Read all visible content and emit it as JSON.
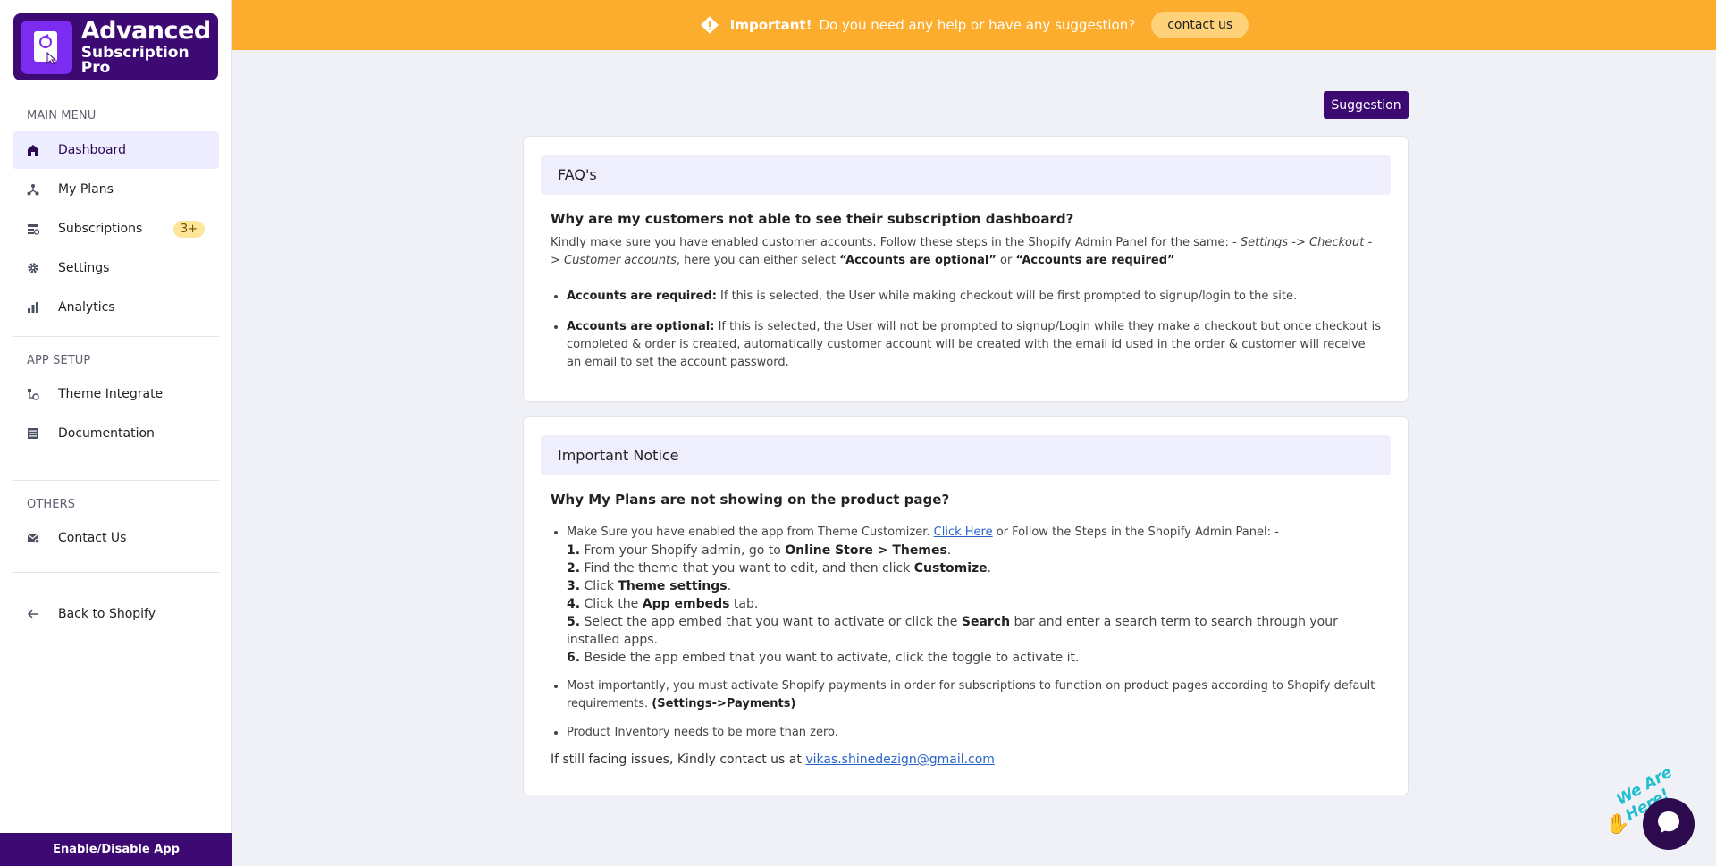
{
  "logo": {
    "line1": "Advanced",
    "line2": "Subscription Pro"
  },
  "sidebar": {
    "main_menu_title": "MAIN MENU",
    "main_items": [
      {
        "label": "Dashboard",
        "icon": "home-icon",
        "active": true
      },
      {
        "label": "My Plans",
        "icon": "plans-icon"
      },
      {
        "label": "Subscriptions",
        "icon": "subscriptions-icon",
        "badge": "3+"
      },
      {
        "label": "Settings",
        "icon": "gear-icon"
      },
      {
        "label": "Analytics",
        "icon": "bar-chart-icon"
      }
    ],
    "app_setup_title": "APP SETUP",
    "setup_items": [
      {
        "label": "Theme Integrate",
        "icon": "theme-icon"
      },
      {
        "label": "Documentation",
        "icon": "document-icon"
      }
    ],
    "others_title": "OTHERS",
    "others_items": [
      {
        "label": "Contact Us",
        "icon": "mail-icon"
      }
    ],
    "back_label": "Back to Shopify",
    "enable_label": "Enable/Disable App"
  },
  "banner": {
    "strong": "Important!",
    "text": "Do you need any help or have any suggestion?",
    "button": "contact us"
  },
  "suggestion_button": "Suggestion",
  "faq": {
    "title": "FAQ's",
    "question": "Why are my customers not able to see their subscription dashboard?",
    "intro_1": "Kindly make sure you have enabled customer accounts. Follow these steps in the Shopify Admin Panel for the same: - ",
    "intro_path": "Settings -> Checkout -> Customer accounts",
    "intro_2": ", here you can either select ",
    "opt_a": "“Accounts are optional”",
    "intro_or": " or ",
    "opt_b": "“Accounts are required”",
    "bullets": [
      {
        "strong": "Accounts are required:",
        "text": " If this is selected, the User while making checkout will be first prompted to signup/login to the site."
      },
      {
        "strong": "Accounts are optional:",
        "text": " If this is selected, the User will not be prompted to signup/Login while they make a checkout but once checkout is completed & order is created, automatically customer account will be created with the email id used in the order & customer will receive an email to set the account password."
      }
    ]
  },
  "notice": {
    "title": "Important Notice",
    "question": "Why My Plans are not showing on the product page?",
    "b1_pre": "Make Sure you have enabled the app from Theme Customizer. ",
    "b1_link": "Click Here",
    "b1_post": " or Follow the Steps in the Shopify Admin Panel: -",
    "steps": [
      {
        "n": "1.",
        "pre": " From your Shopify admin, go to ",
        "b": "Online Store > Themes",
        "post": "."
      },
      {
        "n": "2.",
        "pre": " Find the theme that you want to edit, and then click ",
        "b": "Customize",
        "post": "."
      },
      {
        "n": "3.",
        "pre": " Click ",
        "b": "Theme settings",
        "post": "."
      },
      {
        "n": "4.",
        "pre": " Click the ",
        "b": "App embeds",
        "post": " tab."
      },
      {
        "n": "5.",
        "pre": " Select the app embed that you want to activate or click the ",
        "b": "Search",
        "post": " bar and enter a search term to search through your installed apps."
      },
      {
        "n": "6.",
        "pre": " Beside the app embed that you want to activate, click the toggle to activate it.",
        "b": "",
        "post": ""
      }
    ],
    "b2_text": "Most importantly, you must activate Shopify payments in order for subscriptions to function on product pages according to Shopify default requirements. ",
    "b2_strong": "(Settings->Payments)",
    "b3_text": "Product Inventory needs to be more than zero.",
    "contact_pre": "If still facing issues, Kindly contact us at ",
    "contact_email": "vikas.shinedezign@gmail.com"
  },
  "chat": {
    "label": "We Are Here!"
  }
}
